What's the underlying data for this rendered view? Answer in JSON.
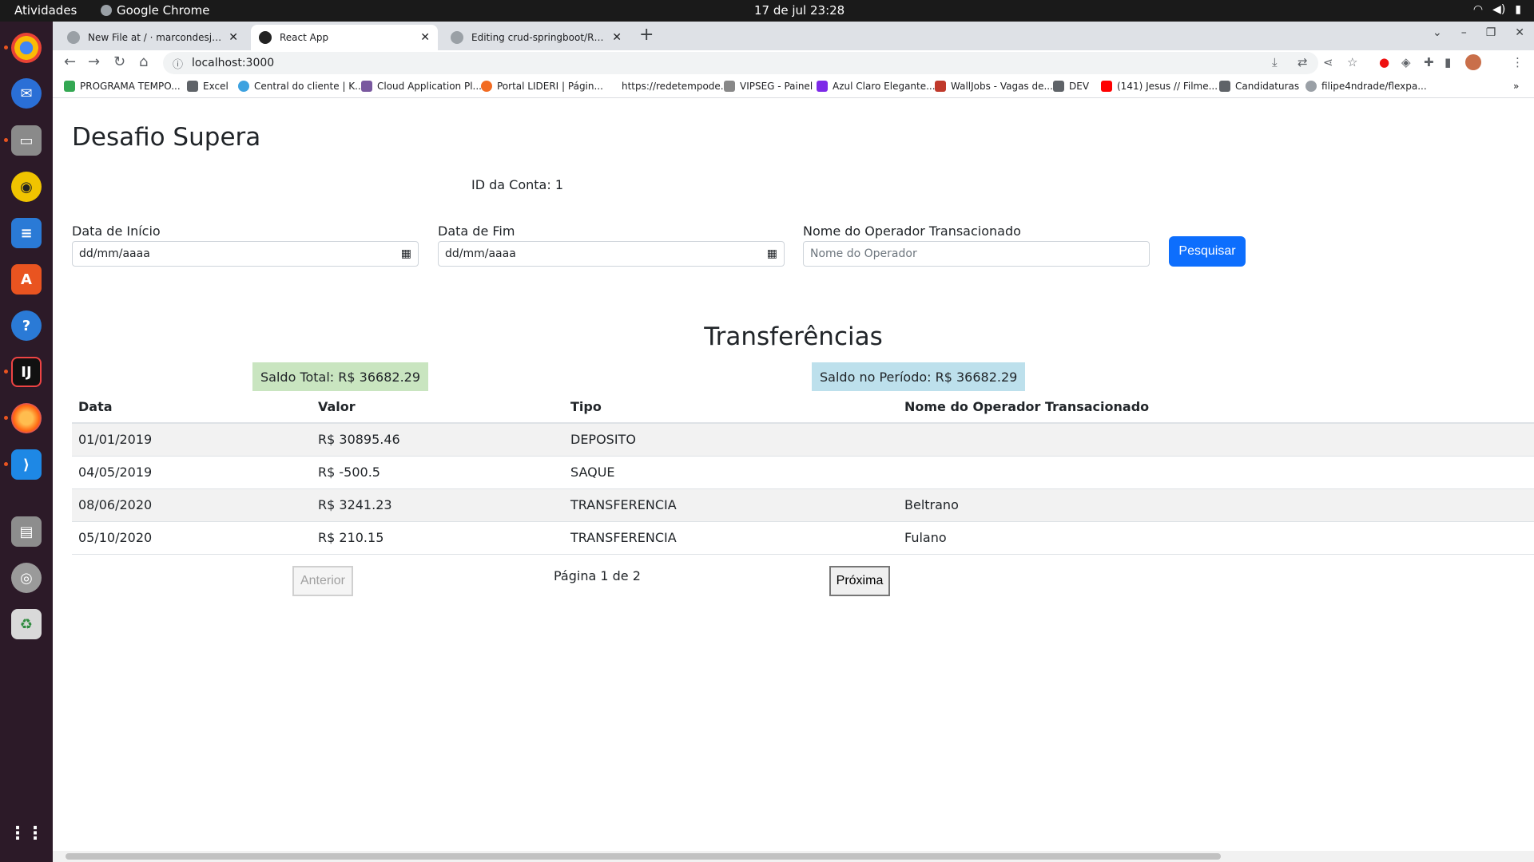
{
  "system": {
    "activities": "Atividades",
    "app_name": "Google Chrome",
    "clock": "17 de jul  23:28"
  },
  "browser": {
    "tabs": [
      {
        "title": "New File at / · marcondesjr96/supe"
      },
      {
        "title": "React App"
      },
      {
        "title": "Editing crud-springboot/README.m"
      }
    ],
    "url": "localhost:3000",
    "bookmarks": [
      {
        "label": "PROGRAMA TEMPO..."
      },
      {
        "label": "Excel"
      },
      {
        "label": "Central do cliente | K..."
      },
      {
        "label": "Cloud Application Pl..."
      },
      {
        "label": "Portal LIDERI | Págin..."
      },
      {
        "label": "https://redetempode..."
      },
      {
        "label": "VIPSEG - Painel"
      },
      {
        "label": "Azul Claro Elegante..."
      },
      {
        "label": "WallJobs - Vagas de..."
      },
      {
        "label": "DEV"
      },
      {
        "label": "(141) Jesus // Filme..."
      },
      {
        "label": "Candidaturas"
      },
      {
        "label": "filipe4ndrade/flexpa..."
      }
    ]
  },
  "app": {
    "title": "Desafio Supera",
    "account_label": "ID da Conta: 1",
    "filters": {
      "start_label": "Data de Início",
      "start_value": "dd/mm/aaaa",
      "end_label": "Data de Fim",
      "end_value": "dd/mm/aaaa",
      "operator_label": "Nome do Operador Transacionado",
      "operator_placeholder": "Nome do Operador",
      "search_button": "Pesquisar"
    },
    "section_title": "Transferências",
    "saldo_total": "Saldo Total: R$ 36682.29",
    "saldo_periodo": "Saldo no Período: R$ 36682.29",
    "table": {
      "headers": [
        "Data",
        "Valor",
        "Tipo",
        "Nome do Operador Transacionado"
      ],
      "rows": [
        [
          "01/01/2019",
          "R$ 30895.46",
          "DEPOSITO",
          ""
        ],
        [
          "04/05/2019",
          "R$ -500.5",
          "SAQUE",
          ""
        ],
        [
          "08/06/2020",
          "R$ 3241.23",
          "TRANSFERENCIA",
          "Beltrano"
        ],
        [
          "05/10/2020",
          "R$ 210.15",
          "TRANSFERENCIA",
          "Fulano"
        ]
      ]
    },
    "pagination": {
      "prev": "Anterior",
      "page_text": "Página 1 de 2",
      "next": "Próxima"
    }
  }
}
